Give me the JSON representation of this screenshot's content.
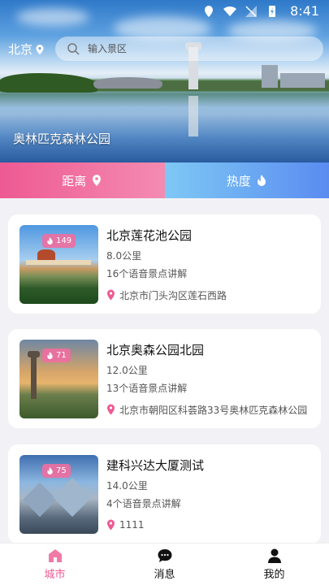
{
  "status_bar": {
    "time": "8:41"
  },
  "header": {
    "city": "北京",
    "search_placeholder": "输入景区"
  },
  "hero": {
    "title": "奥林匹克森林公园"
  },
  "sort_tabs": [
    {
      "label": "距离",
      "icon": "location-pin-icon",
      "color": "#ee5a93"
    },
    {
      "label": "热度",
      "icon": "flame-icon",
      "color": "#5a8cf0"
    }
  ],
  "spots": [
    {
      "name": "北京莲花池公园",
      "distance": "8.0公里",
      "audio": "16个语音景点讲解",
      "address": "北京市门头沟区莲石西路",
      "heat": "149"
    },
    {
      "name": "北京奥森公园北园",
      "distance": "12.0公里",
      "audio": "13个语音景点讲解",
      "address": "北京市朝阳区科荟路33号奥林匹克森林公园",
      "heat": "71"
    },
    {
      "name": "建科兴达大厦测试",
      "distance": "14.0公里",
      "audio": "4个语音景点讲解",
      "address": "1111",
      "heat": "75"
    }
  ],
  "bottom_nav": [
    {
      "label": "城市",
      "icon": "home-icon",
      "active": true
    },
    {
      "label": "消息",
      "icon": "chat-bubble-icon",
      "active": false
    },
    {
      "label": "我的",
      "icon": "person-icon",
      "active": false
    }
  ],
  "colors": {
    "accent_pink": "#ee5a93",
    "accent_blue": "#5a8cf0",
    "background": "#f2f2f6"
  }
}
